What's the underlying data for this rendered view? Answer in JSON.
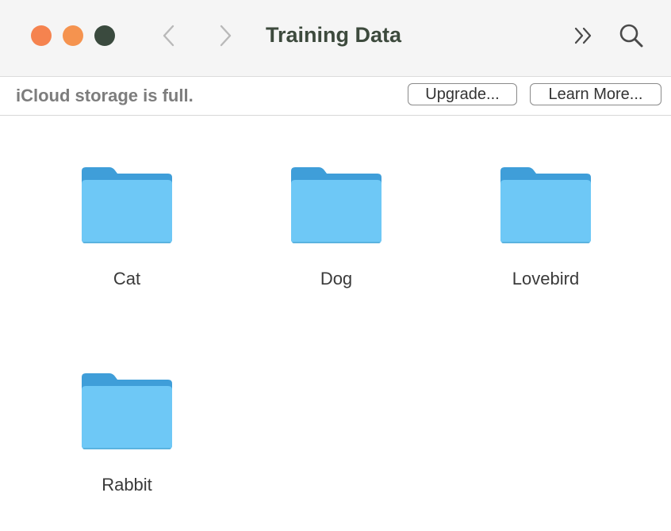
{
  "window": {
    "title": "Training Data"
  },
  "toolbar": {
    "traffic_lights": {
      "close_color": "#f5834f",
      "minimize_color": "#f5934f",
      "zoom_color": "#3a4a3e"
    },
    "back_icon": "chevron-left-icon",
    "forward_icon": "chevron-right-icon",
    "more_icon": "double-chevron-right-icon",
    "search_icon": "magnifying-glass-icon"
  },
  "banner": {
    "message": "iCloud storage is full.",
    "upgrade_label": "Upgrade...",
    "learn_more_label": "Learn More..."
  },
  "folders": [
    {
      "name": "Cat"
    },
    {
      "name": "Dog"
    },
    {
      "name": "Lovebird"
    },
    {
      "name": "Rabbit"
    }
  ],
  "colors": {
    "folder_back": "#3f9ed9",
    "folder_front": "#6ec8f6",
    "title_text": "#3d4a3d"
  }
}
